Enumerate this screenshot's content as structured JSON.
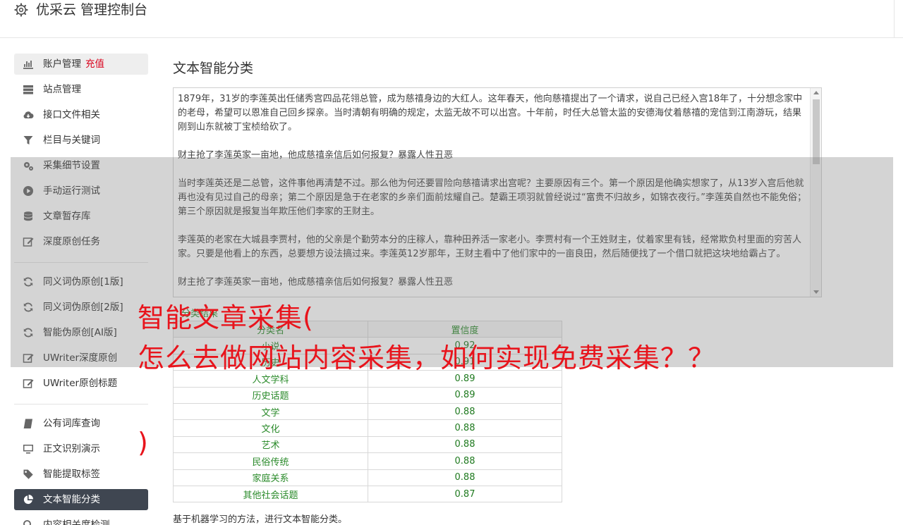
{
  "app": {
    "title": "优采云 管理控制台"
  },
  "sidebar": {
    "items": [
      {
        "label": "账户管理",
        "extra": "充值",
        "icon": "bar-chart-icon"
      },
      {
        "label": "站点管理",
        "icon": "server-icon"
      },
      {
        "label": "接口文件相关",
        "icon": "cloud-download-icon"
      },
      {
        "label": "栏目与关键词",
        "icon": "filter-icon"
      },
      {
        "label": "采集细节设置",
        "icon": "gears-icon"
      },
      {
        "label": "手动运行测试",
        "icon": "play-circle-icon"
      },
      {
        "label": "文章暂存库",
        "icon": "database-icon"
      },
      {
        "label": "深度原创任务",
        "icon": "edit-icon"
      },
      {
        "label": "同义词伪原创[1版]",
        "icon": "refresh-icon"
      },
      {
        "label": "同义词伪原创[2版]",
        "icon": "refresh-icon"
      },
      {
        "label": "智能伪原创[AI版]",
        "icon": "refresh-icon"
      },
      {
        "label": "UWriter深度原创",
        "icon": "edit-icon"
      },
      {
        "label": "UWriter原创标题",
        "icon": "edit-icon"
      },
      {
        "label": "公有词库查询",
        "icon": "book-icon"
      },
      {
        "label": "正文识别演示",
        "icon": "monitor-icon"
      },
      {
        "label": "智能提取标签",
        "icon": "tag-icon"
      },
      {
        "label": "文本智能分类",
        "icon": "pie-chart-icon"
      },
      {
        "label": "内容相关度检测",
        "icon": "search-icon"
      }
    ]
  },
  "main": {
    "title": "文本智能分类",
    "text_paragraphs": [
      "1879年，31岁的李莲英出任储秀宫四品花翎总管，成为慈禧身边的大红人。这年春天，他向慈禧提出了一个请求，说自己已经入宫18年了，十分想念家中的老母，希望可以恩准自己回乡探亲。当时清朝有明确的规定，太监无故不可以出宫。十年前，时任大总管太监的安德海仗着慈禧的宠信到江南游玩，结果刚到山东就被丁宝桢给砍了。",
      "财主抢了李莲英家一亩地，他成慈禧亲信后如何报复？暴露人性丑恶",
      "当时李莲英还是二总管，这件事他再清楚不过。那么他为何还要冒险向慈禧请求出宫呢？主要原因有三个。第一个原因是他确实想家了，从13岁入宫后他就再也没有见过自己的母亲；第二个原因是急于在老家的乡亲们面前炫耀自己。楚霸王项羽就曾经说过“富贵不归故乡，如锦衣夜行。”李莲英自然也不能免俗；第三个原因就是报复当年欺压他们李家的王财主。",
      "李莲英的老家在大城县李贾村，他的父亲是个勤劳本分的庄稼人，靠种田养活一家老小。李贾村有一个王姓财主，仗着家里有钱，经常欺负村里面的穷苦人家。只要是他看上的东西，总要想方设法搞过来。李莲英12岁那年，王财主看中了他们家中的一亩良田，然后随便找了一个借口就把这块地给霸占了。",
      "财主抢了李莲英家一亩地，他成慈禧亲信后如何报复？暴露人性丑恶"
    ],
    "result_label": "分类结果",
    "table": {
      "headers": [
        "分类名",
        "置信度"
      ],
      "rows": [
        [
          "小说",
          "0.92"
        ],
        [
          "历史",
          "0.91"
        ],
        [
          "人文学科",
          "0.89"
        ],
        [
          "历史话题",
          "0.89"
        ],
        [
          "文学",
          "0.88"
        ],
        [
          "文化",
          "0.88"
        ],
        [
          "艺术",
          "0.88"
        ],
        [
          "民俗传统",
          "0.88"
        ],
        [
          "家庭关系",
          "0.88"
        ],
        [
          "其他社会话题",
          "0.87"
        ]
      ]
    },
    "note": "基于机器学习的方法，进行文本智能分类。"
  },
  "overlay": {
    "line1": "智能文章采集(",
    "line2": "怎么去做网站内容采集，如何实现免费采集？？",
    "line3": ")"
  },
  "colors": {
    "accent_red": "#e8141c",
    "recharge_red": "#d9001b",
    "active_bg": "#3f4651",
    "result_green": "#2a8a2a"
  }
}
